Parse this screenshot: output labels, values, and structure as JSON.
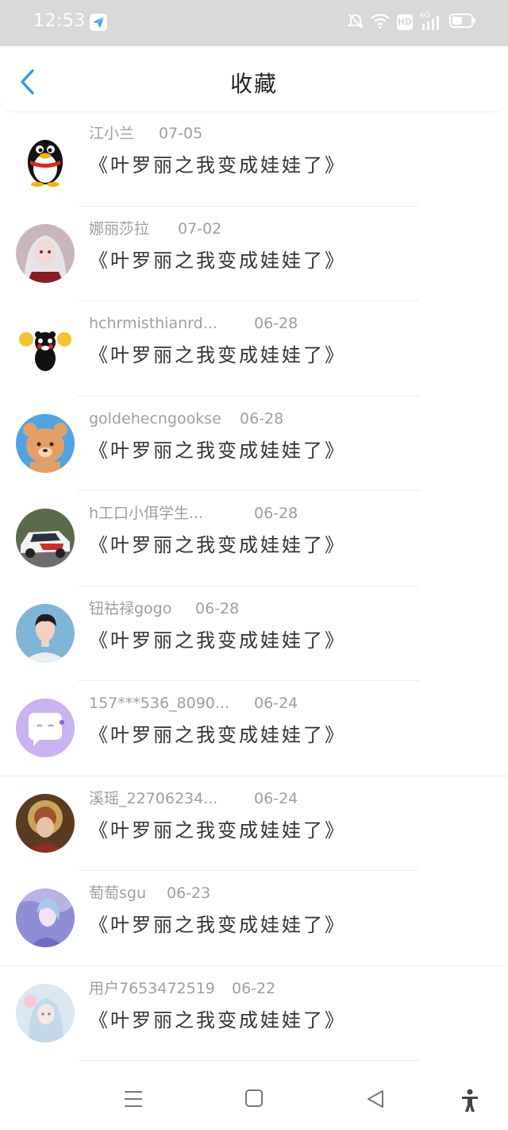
{
  "status_bar": {
    "time": "12:53",
    "network": "4G",
    "hd": "HD"
  },
  "header": {
    "title": "收藏"
  },
  "items": [
    {
      "name": "江小兰",
      "date": "07-05",
      "content": "《叶罗丽之我变成娃娃了》"
    },
    {
      "name": "娜丽莎拉",
      "date": "07-02",
      "content": "《叶罗丽之我变成娃娃了》"
    },
    {
      "name": "hchrmisthianrd...",
      "date": "06-28",
      "content": "《叶罗丽之我变成娃娃了》"
    },
    {
      "name": "goldehecngookse",
      "date": "06-28",
      "content": "《叶罗丽之我变成娃娃了》"
    },
    {
      "name": "h工口小佴学生...",
      "date": "06-28",
      "content": "《叶罗丽之我变成娃娃了》"
    },
    {
      "name": "钮祜禄gogo",
      "date": "06-28",
      "content": "《叶罗丽之我变成娃娃了》"
    },
    {
      "name": "157***536_8090...",
      "date": "06-24",
      "content": "《叶罗丽之我变成娃娃了》"
    },
    {
      "name": "溪瑶_22706234...",
      "date": "06-24",
      "content": "《叶罗丽之我变成娃娃了》"
    },
    {
      "name": "萄萄sgu",
      "date": "06-23",
      "content": "《叶罗丽之我变成娃娃了》"
    },
    {
      "name": "用户7653472519",
      "date": "06-22",
      "content": "《叶罗丽之我变成娃娃了》"
    }
  ],
  "colors": {
    "accent": "#2e9bea",
    "meta_text": "#9e9e9e",
    "content_text": "#333333",
    "status_bar_bg": "#d9d9d9"
  }
}
